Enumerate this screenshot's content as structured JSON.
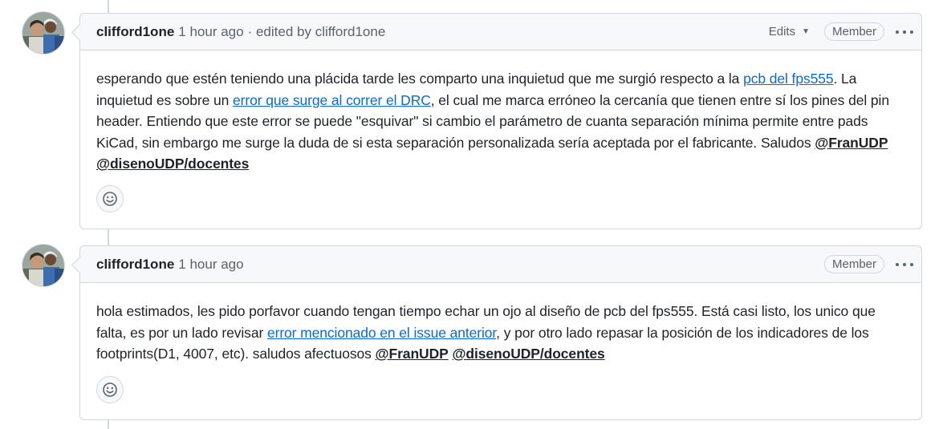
{
  "comments": [
    {
      "author": "clifford1one",
      "time": "1 hour ago",
      "edited_text": "· edited by clifford1one",
      "edits_label": "Edits",
      "badge": "Member",
      "body": {
        "t1": "esperando que estén teniendo una plácida tarde les comparto una inquietud que me surgió respecto a la ",
        "link1": "pcb del fps555",
        "t2": ". La inquietud es sobre un ",
        "link2": "error que surge al correr el DRC",
        "t3": ", el cual me marca erróneo la cercanía que tienen entre sí los pines del pin header. Entiendo que este error se puede \"esquivar\" si cambio el parámetro de cuanta separación mínima permite entre pads KiCad, sin embargo me surge la duda de si esta separación personalizada sería aceptada por el fabricante. Saludos ",
        "mention1": "@FranUDP",
        "t4": " ",
        "mention2": "@disenoUDP/docentes"
      }
    },
    {
      "author": "clifford1one",
      "time": "1 hour ago",
      "badge": "Member",
      "body": {
        "t1": "hola estimados, les pido porfavor cuando tengan tiempo echar un ojo al diseño de pcb del fps555. Está casi listo, los unico que falta, es por un lado revisar ",
        "link1": "error mencionado en el issue anterior",
        "t2": ", y por otro lado repasar la posición de los indicadores de los footprints(D1, 4007, etc). saludos afectuosos ",
        "mention1": "@FranUDP",
        "t3": " ",
        "mention2": "@disenoUDP/docentes"
      }
    }
  ],
  "icons": {
    "avatar": "avatar-photo",
    "reaction": "smiley-icon",
    "menu": "kebab-horizontal-icon",
    "caret": "triangle-down-icon"
  },
  "colors": {
    "link": "#0969da",
    "border": "#d0d7de",
    "header_bg": "#f6f8fa",
    "muted": "#59636e"
  }
}
